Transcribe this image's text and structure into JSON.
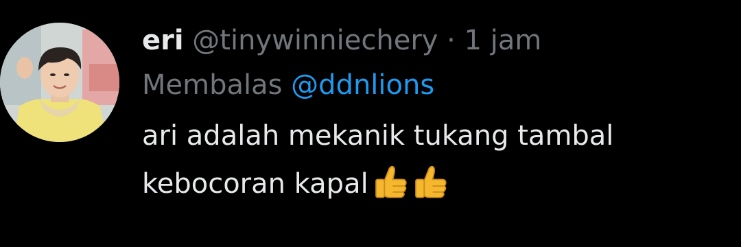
{
  "tweet": {
    "author": {
      "display_name": "eri",
      "handle": "@tinywinniechery",
      "avatar_icon": "profile-photo"
    },
    "separator": "·",
    "timestamp": "1 jam",
    "reply": {
      "prefix": "Membalas",
      "mention": "@ddnlions"
    },
    "text_line1": "ari adalah mekanik tukang tambal",
    "text_line2": "kebocoran kapal",
    "emojis": [
      "thumbs-up-icon",
      "thumbs-up-icon"
    ]
  },
  "colors": {
    "background": "#000000",
    "primary_text": "#e7e9ea",
    "secondary_text": "#71767b",
    "link": "#1d9bf0",
    "emoji": "#f5b72e"
  }
}
